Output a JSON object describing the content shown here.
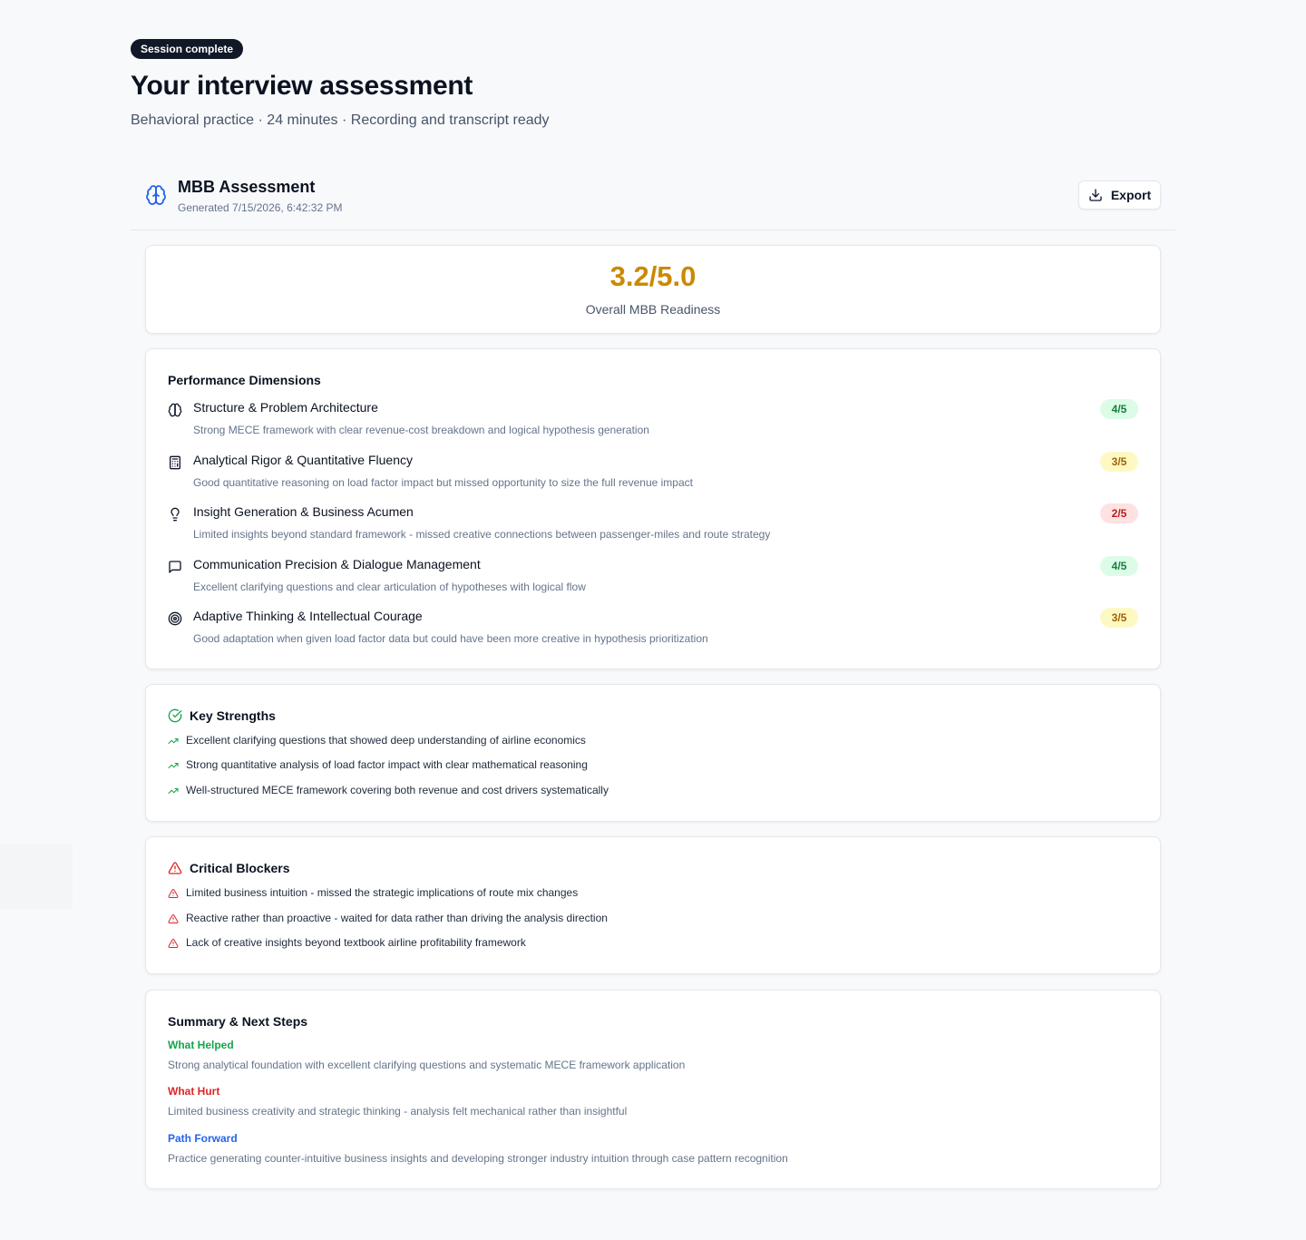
{
  "header": {
    "badge": "Session complete",
    "title": "Your interview assessment",
    "subtitle": "Behavioral practice · 24 minutes · Recording and transcript ready"
  },
  "report": {
    "title": "MBB Assessment",
    "generated": "Generated 7/15/2026, 6:42:32 PM",
    "export_label": "Export",
    "logo_icon": "brain-icon"
  },
  "score": {
    "value": "3.2/5.0",
    "label": "Overall MBB Readiness",
    "color": "#ca8a04"
  },
  "dimensions": {
    "title": "Performance Dimensions",
    "items": [
      {
        "icon": "brain-icon",
        "name": "Structure & Problem Architecture",
        "description": "Strong MECE framework with clear revenue-cost breakdown and logical hypothesis generation",
        "score": "4/5",
        "level": "green"
      },
      {
        "icon": "calculator-icon",
        "name": "Analytical Rigor & Quantitative Fluency",
        "description": "Good quantitative reasoning on load factor impact but missed opportunity to size the full revenue impact",
        "score": "3/5",
        "level": "yellow"
      },
      {
        "icon": "lightbulb-icon",
        "name": "Insight Generation & Business Acumen",
        "description": "Limited insights beyond standard framework - missed creative connections between passenger-miles and route strategy",
        "score": "2/5",
        "level": "red"
      },
      {
        "icon": "message-square-icon",
        "name": "Communication Precision & Dialogue Management",
        "description": "Excellent clarifying questions and clear articulation of hypotheses with logical flow",
        "score": "4/5",
        "level": "green"
      },
      {
        "icon": "target-icon",
        "name": "Adaptive Thinking & Intellectual Courage",
        "description": "Good adaptation when given load factor data but could have been more creative in hypothesis prioritization",
        "score": "3/5",
        "level": "yellow"
      }
    ]
  },
  "strengths": {
    "title": "Key Strengths",
    "icon": "check-circle-icon",
    "item_icon": "trending-up-icon",
    "color": "#16a34a",
    "items": [
      "Excellent clarifying questions that showed deep understanding of airline economics",
      "Strong quantitative analysis of load factor impact with clear mathematical reasoning",
      "Well-structured MECE framework covering both revenue and cost drivers systematically"
    ]
  },
  "blockers": {
    "title": "Critical Blockers",
    "icon": "alert-triangle-icon",
    "item_icon": "alert-triangle-icon",
    "color": "#dc2626",
    "items": [
      "Limited business intuition - missed the strategic implications of route mix changes",
      "Reactive rather than proactive - waited for data rather than driving the analysis direction",
      "Lack of creative insights beyond textbook airline profitability framework"
    ]
  },
  "summary": {
    "title": "Summary & Next Steps",
    "helped_label": "What Helped",
    "helped_text": "Strong analytical foundation with excellent clarifying questions and systematic MECE framework application",
    "hurt_label": "What Hurt",
    "hurt_text": "Limited business creativity and strategic thinking - analysis felt mechanical rather than insightful",
    "forward_label": "Path Forward",
    "forward_text": "Practice generating counter-intuitive business insights and developing stronger industry intuition through case pattern recognition",
    "colors": {
      "helped": "#16a34a",
      "hurt": "#dc2626",
      "forward": "#2563eb"
    }
  }
}
